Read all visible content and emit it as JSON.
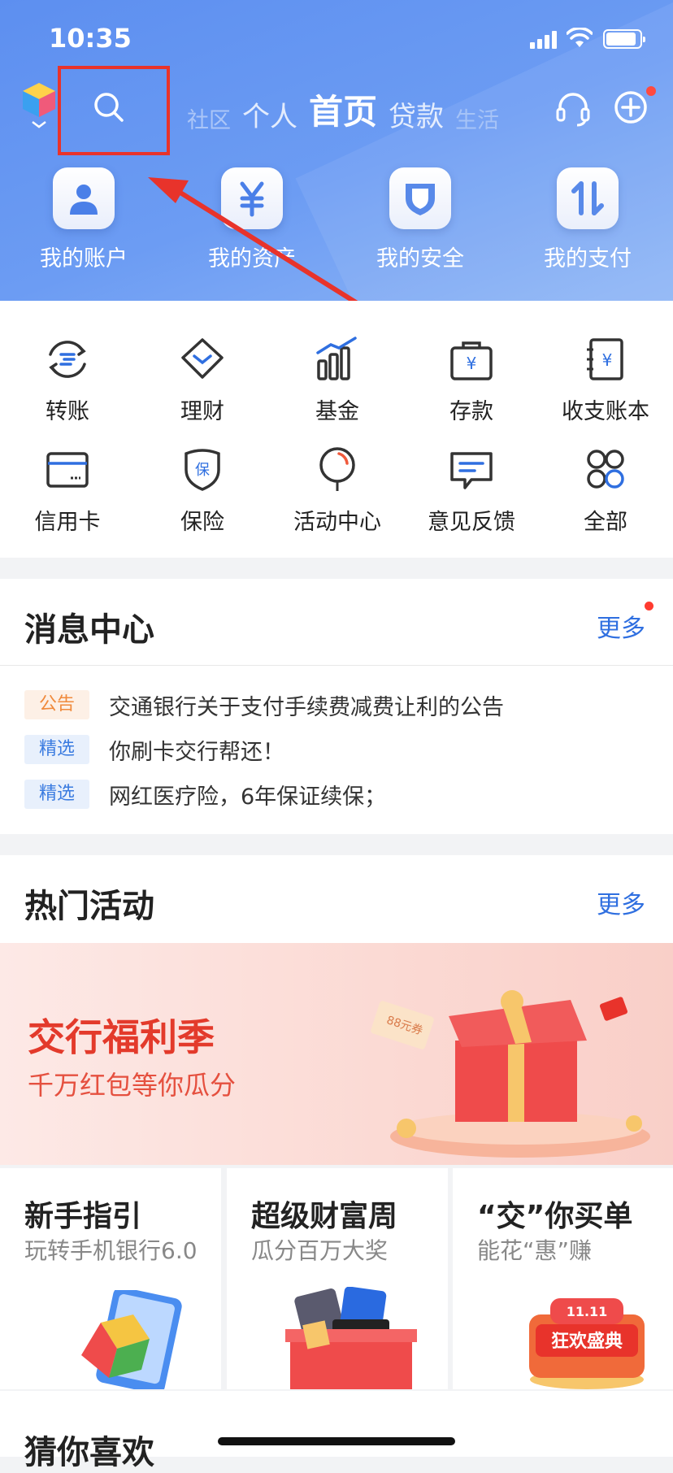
{
  "status_bar": {
    "time": "10:35"
  },
  "header": {
    "tabs": [
      "社区",
      "个人",
      "首页",
      "贷款",
      "生活"
    ],
    "active_tab": "首页"
  },
  "quick_actions": [
    {
      "label": "我的账户",
      "icon": "user-icon"
    },
    {
      "label": "我的资产",
      "icon": "yuan-icon"
    },
    {
      "label": "我的安全",
      "icon": "shield-icon"
    },
    {
      "label": "我的支付",
      "icon": "transfer-arrows-icon"
    }
  ],
  "services": [
    {
      "label": "转账",
      "icon": "transfer-icon"
    },
    {
      "label": "理财",
      "icon": "diamond-icon"
    },
    {
      "label": "基金",
      "icon": "bar-chart-icon"
    },
    {
      "label": "存款",
      "icon": "deposit-bag-icon"
    },
    {
      "label": "收支账本",
      "icon": "ledger-icon"
    },
    {
      "label": "信用卡",
      "icon": "credit-card-icon"
    },
    {
      "label": "保险",
      "icon": "insurance-shield-icon"
    },
    {
      "label": "活动中心",
      "icon": "balloon-icon"
    },
    {
      "label": "意见反馈",
      "icon": "feedback-icon"
    },
    {
      "label": "全部",
      "icon": "grid-icon"
    }
  ],
  "messages": {
    "title": "消息中心",
    "more": "更多",
    "items": [
      {
        "badge": "公告",
        "badge_color": "#f08a3c",
        "badge_bg": "#fdf0e6",
        "text": "交通银行关于支付手续费减费让利的公告"
      },
      {
        "badge": "精选",
        "badge_color": "#3a7be0",
        "badge_bg": "#e8f0fc",
        "text": "你刷卡交行帮还！"
      },
      {
        "badge": "精选",
        "badge_color": "#3a7be0",
        "badge_bg": "#e8f0fc",
        "text": "网红医疗险，6年保证续保；"
      }
    ]
  },
  "activities": {
    "title": "热门活动",
    "more": "更多",
    "banner": {
      "title": "交行福利季",
      "subtitle": "千万红包等你瓜分",
      "coupon_left": "88元券"
    },
    "cards": [
      {
        "title": "新手指引",
        "subtitle": "玩转手机银行6.0"
      },
      {
        "title": "超级财富周",
        "subtitle": "瓜分百万大奖"
      },
      {
        "title": "“交”你买单",
        "subtitle": "能花“惠”赚",
        "badge_top": "11.11",
        "badge_main": "狂欢盛典"
      }
    ]
  },
  "recommend": {
    "title": "猜你喜欢"
  },
  "colors": {
    "primary_blue": "#5d8ff0",
    "accent_red": "#e8332b",
    "link_blue": "#2f6fe0"
  }
}
